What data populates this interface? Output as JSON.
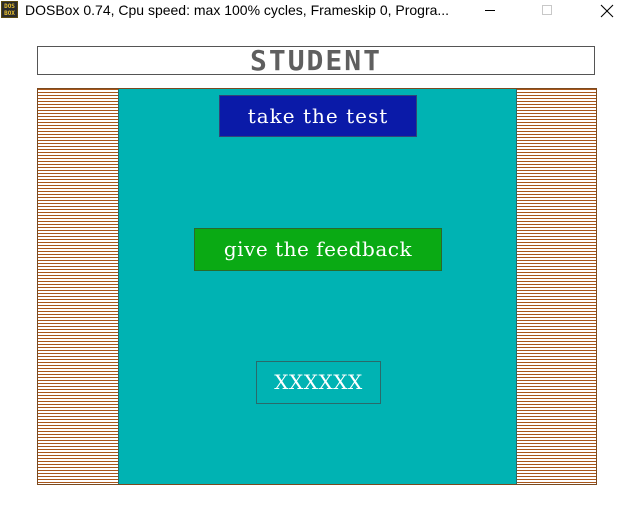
{
  "window": {
    "icon_text": "DOS BOX",
    "title": "DOSBox 0.74, Cpu speed: max 100% cycles, Frameskip  0, Progra..."
  },
  "app": {
    "header_title": "STUDENT",
    "buttons": {
      "take_test": "take the test",
      "feedback": "give the feedback",
      "third": "XXXXXX"
    }
  },
  "colors": {
    "header_text": "#5f5f5f",
    "stripe": "#a8561a",
    "center_panel": "#00b3b3",
    "take_test_bg": "#0a1aa8",
    "feedback_bg": "#0aaa14"
  },
  "icons": [
    "dosbox-app-icon",
    "minimize-icon",
    "maximize-icon",
    "close-icon"
  ]
}
